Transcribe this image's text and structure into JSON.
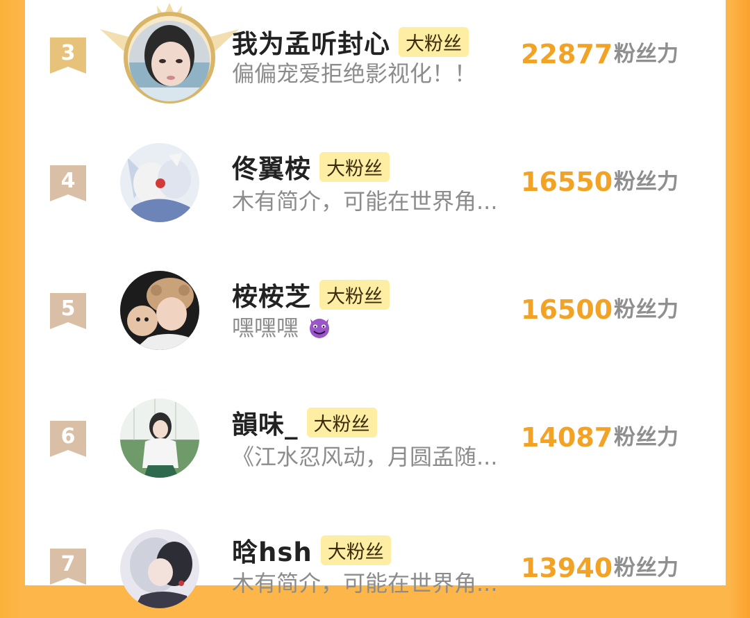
{
  "colors": {
    "background_orange": "#fdb64a",
    "score_orange": "#f2a326",
    "badge_yellow": "#fdeea3",
    "rank_tag": "#d9bfa6",
    "rank_tag_top3": "#e6c27a"
  },
  "score_unit_label": "粉丝力",
  "rankings": [
    {
      "rank": "3",
      "name": "我为孟听封心",
      "badge": "大粉丝",
      "bio": "偏偏宠爱拒绝影视化！！",
      "score": "22877",
      "avatar": "avatar-photo-girl",
      "crown": "crown-frame-icon"
    },
    {
      "rank": "4",
      "name": "佟翼桉",
      "badge": "大粉丝",
      "bio": "木有简介，可能在世界角...",
      "score": "16550",
      "avatar": "avatar-anime-fox"
    },
    {
      "rank": "5",
      "name": "桉桉芝",
      "badge": "大粉丝",
      "bio": "嘿嘿嘿",
      "bio_emoji": "smiling-devil-emoji",
      "score": "16500",
      "avatar": "avatar-photo-plush"
    },
    {
      "rank": "6",
      "name": "韻味_",
      "badge": "大粉丝",
      "bio": "《江水忍风动，月圆孟随...",
      "score": "14087",
      "avatar": "avatar-photo-outdoor"
    },
    {
      "rank": "7",
      "name": "晗hsh",
      "badge": "大粉丝",
      "bio": "木有简介，可能在世界角...",
      "score": "13940",
      "avatar": "avatar-anime-couple"
    }
  ]
}
